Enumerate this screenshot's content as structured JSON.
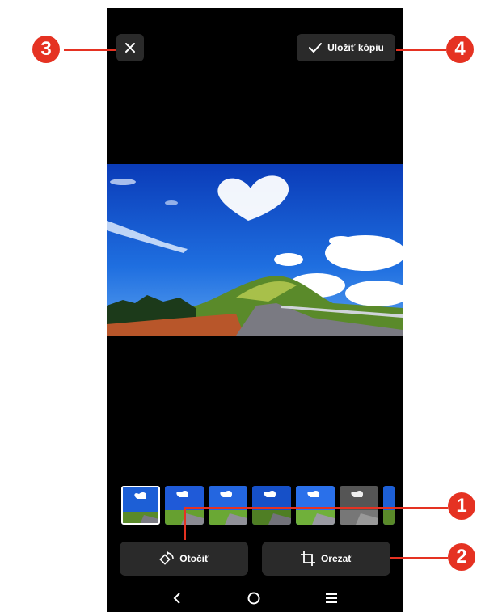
{
  "header": {
    "close_icon": "close-icon",
    "save_label": "Uložiť kópiu",
    "save_icon": "check-icon"
  },
  "tools": {
    "rotate_label": "Otočiť",
    "rotate_icon": "rotate-icon",
    "crop_label": "Orezať",
    "crop_icon": "crop-icon"
  },
  "filters": {
    "count_visible": 7,
    "selected_index": 0
  },
  "nav": {
    "back_icon": "back-icon",
    "home_icon": "home-icon",
    "menu_icon": "menu-icon"
  },
  "callouts": [
    "1",
    "2",
    "3",
    "4"
  ],
  "colors": {
    "callout": "#e53222",
    "button_bg": "#2a2a2a",
    "background": "#000000"
  }
}
